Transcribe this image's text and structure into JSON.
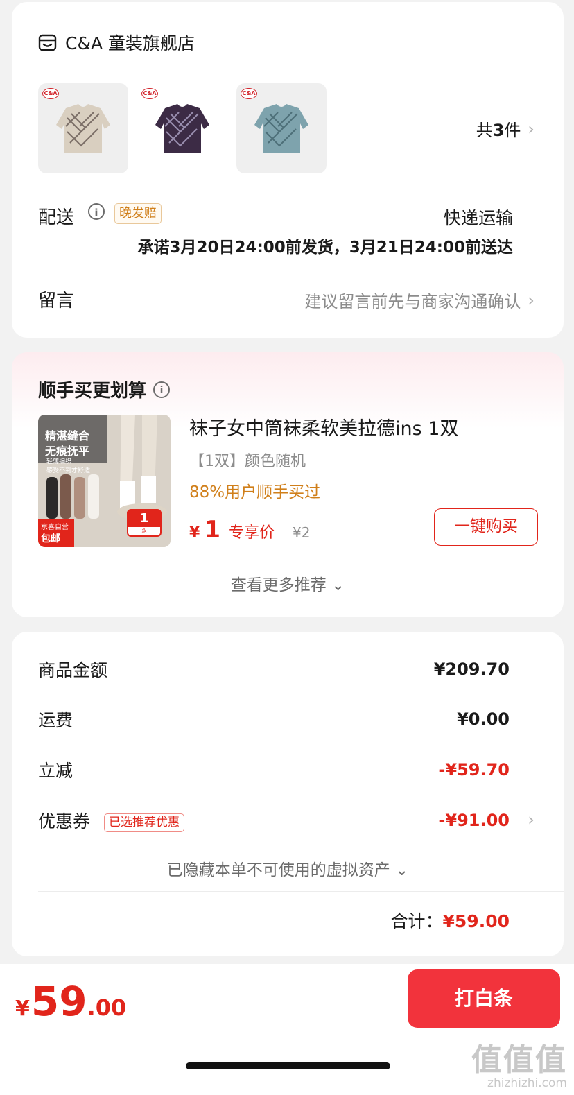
{
  "store": {
    "icon": "store-icon",
    "name": "C&A 童装旗舰店",
    "items": [
      {
        "color": "#d9cfc0",
        "pattern": "#7a6d66",
        "logo": "C&A"
      },
      {
        "color": "#3c2b45",
        "pattern": "#9a8fb0",
        "logo": "C&A"
      },
      {
        "color": "#7ea3ad",
        "pattern": "#4d6f78",
        "logo": "C&A"
      }
    ],
    "count_prefix": "共",
    "count_number": "3",
    "count_suffix": "件",
    "delivery_label": "配送",
    "late_badge": "晚发赔",
    "delivery_method": "快递运输",
    "delivery_promise": "承诺3月20日24:00前发货，3月21日24:00前送达",
    "message_label": "留言",
    "message_placeholder": "建议留言前先与商家沟通确认"
  },
  "recommend": {
    "title": "顺手买更划算",
    "image_tag": "精湛缝合\n无痕抚平",
    "image_sub": "轻薄编织\n感受不到才舒适",
    "image_jd_line1": "京喜自营",
    "image_jd_line2": "包邮",
    "image_pill_number": "1",
    "image_pill_unit": "双",
    "product_name": "袜子女中筒袜柔软美拉德ins 1双",
    "product_spec": "【1双】颜色随机",
    "social_proof": "88%用户顺手买过",
    "price_currency": "¥",
    "price": "1",
    "price_label": "专享价",
    "original_price": "¥2",
    "buy_button": "一键购买",
    "more": "查看更多推荐 ⌄"
  },
  "summary": {
    "rows": [
      {
        "label": "商品金额",
        "value": "¥209.70"
      },
      {
        "label": "运费",
        "value": "¥0.00"
      },
      {
        "label": "立减",
        "value": "-¥59.70"
      },
      {
        "label": "优惠券",
        "value": "-¥91.00"
      }
    ],
    "coupon_badge": "已选推荐优惠",
    "hidden_assets": "已隐藏本单不可使用的虚拟资产 ⌄",
    "total_label": "合计：",
    "total_value": "¥59.00"
  },
  "footer": {
    "currency": "¥",
    "amount_int": "59",
    "amount_dec": ".00",
    "pay_button": "打白条"
  },
  "watermark": {
    "big": "值值值",
    "small": "zhizhizhi.com"
  },
  "colors": {
    "accent_red": "#e1251b",
    "pay_button": "#f2333c",
    "orange": "#d07f1a"
  }
}
